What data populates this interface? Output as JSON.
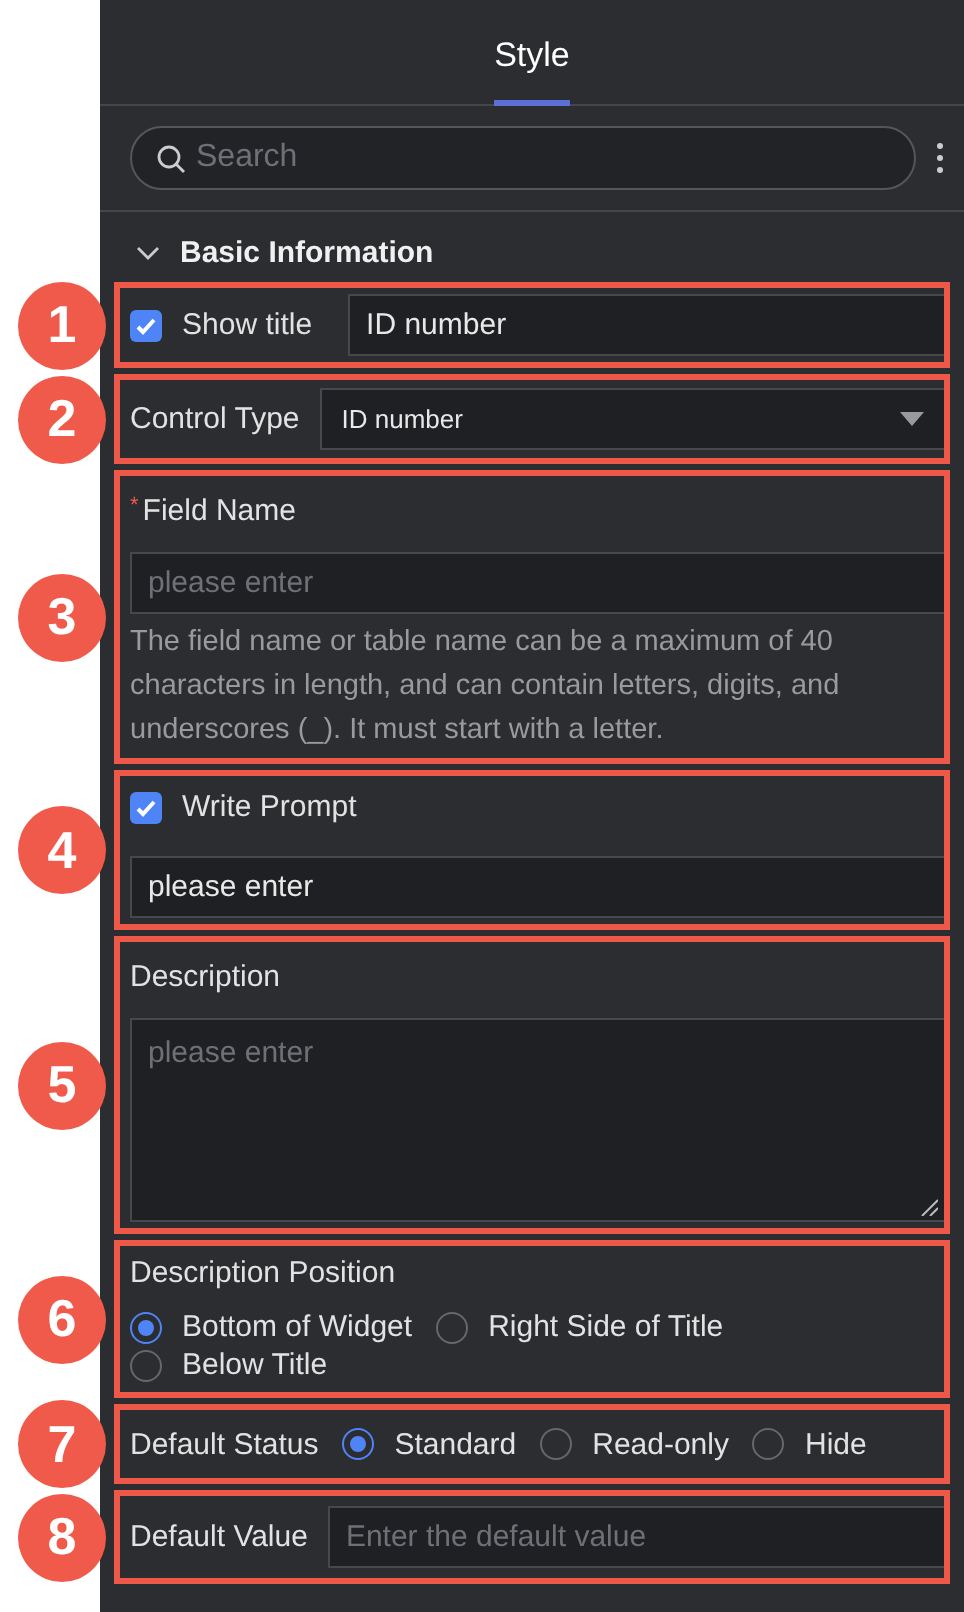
{
  "header": {
    "tab": "Style",
    "selected": true
  },
  "search": {
    "placeholder": "Search"
  },
  "group": {
    "title": "Basic Information",
    "expanded": true
  },
  "sections": [
    {
      "kind": "checkbox-input",
      "callout": "1",
      "label": "Show title",
      "checked": true,
      "value": "ID number"
    },
    {
      "kind": "select",
      "callout": "2",
      "label": "Control Type",
      "value": "ID number"
    },
    {
      "kind": "text-field",
      "callout": "3",
      "label": "Field Name",
      "required_mark": "*",
      "placeholder": "please enter",
      "help": "The field name or table name can be a maximum of 40 characters in length, and can contain letters, digits, and underscores (_). It must start with a letter."
    },
    {
      "kind": "checkbox-field",
      "callout": "4",
      "label": "Write Prompt",
      "checked": true,
      "value": "please enter"
    },
    {
      "kind": "textarea",
      "callout": "5",
      "label": "Description",
      "placeholder": "please enter"
    },
    {
      "kind": "radio-block",
      "callout": "6",
      "label": "Description Position",
      "options": [
        {
          "label": "Bottom of Widget",
          "selected": true
        },
        {
          "label": "Right Side of Title",
          "selected": false
        },
        {
          "label": "Below Title",
          "selected": false
        }
      ]
    },
    {
      "kind": "radio-inline",
      "callout": "7",
      "label": "Default Status",
      "options": [
        {
          "label": "Standard",
          "selected": true
        },
        {
          "label": "Read-only",
          "selected": false
        },
        {
          "label": "Hide",
          "selected": false
        }
      ]
    },
    {
      "kind": "input-inline",
      "callout": "8",
      "label": "Default Value",
      "placeholder": "Enter the default value"
    }
  ]
}
